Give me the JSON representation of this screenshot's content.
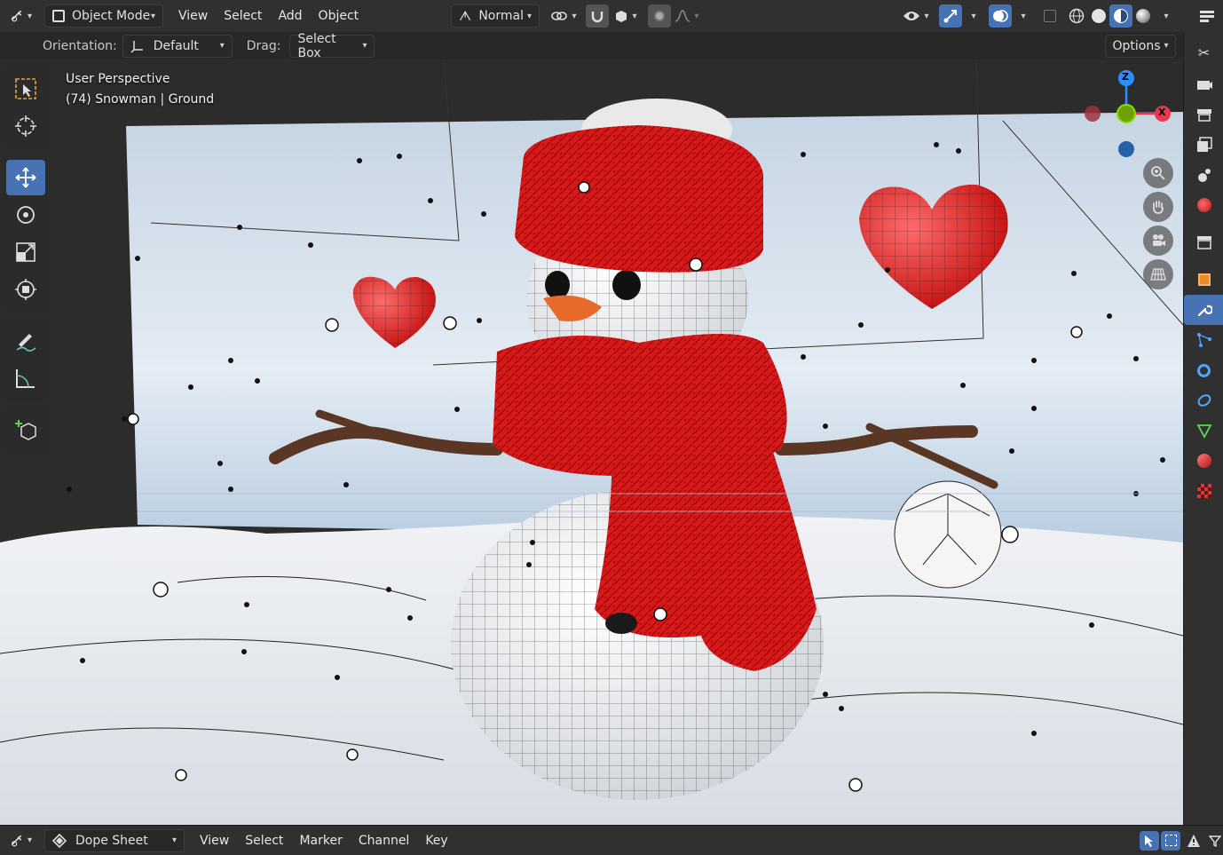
{
  "header": {
    "mode": "Object Mode",
    "menus": [
      "View",
      "Select",
      "Add",
      "Object"
    ],
    "transform_orientation": "Normal"
  },
  "tool_settings": {
    "orientation_label": "Orientation:",
    "orientation_value": "Default",
    "drag_label": "Drag:",
    "drag_value": "Select Box",
    "options_label": "Options"
  },
  "viewport": {
    "line1": "User Perspective",
    "line2": "(74) Snowman | Ground",
    "gizmo": {
      "z": "Z",
      "x": "X"
    }
  },
  "bottom": {
    "editor": "Dope Sheet",
    "menus": [
      "View",
      "Select",
      "Marker",
      "Channel",
      "Key"
    ]
  },
  "colors": {
    "accent": "#4772b3",
    "axis_x": "#e8384f",
    "axis_y": "#8bdc00",
    "axis_z": "#2c8fff",
    "header_bg": "#303030"
  },
  "icons": {
    "toolbar": [
      "select-box-icon",
      "cursor-icon",
      "move-icon",
      "rotate-icon",
      "scale-icon",
      "transform-icon",
      "annotate-icon",
      "measure-icon",
      "add-cube-icon"
    ],
    "properties": [
      "tool-icon",
      "render-icon",
      "output-icon",
      "view-layer-icon",
      "scene-icon",
      "world-icon",
      "collection-icon",
      "object-icon",
      "modifier-icon",
      "particles-icon",
      "physics-icon",
      "constraints-icon",
      "data-icon",
      "material-icon",
      "texture-icon"
    ]
  }
}
